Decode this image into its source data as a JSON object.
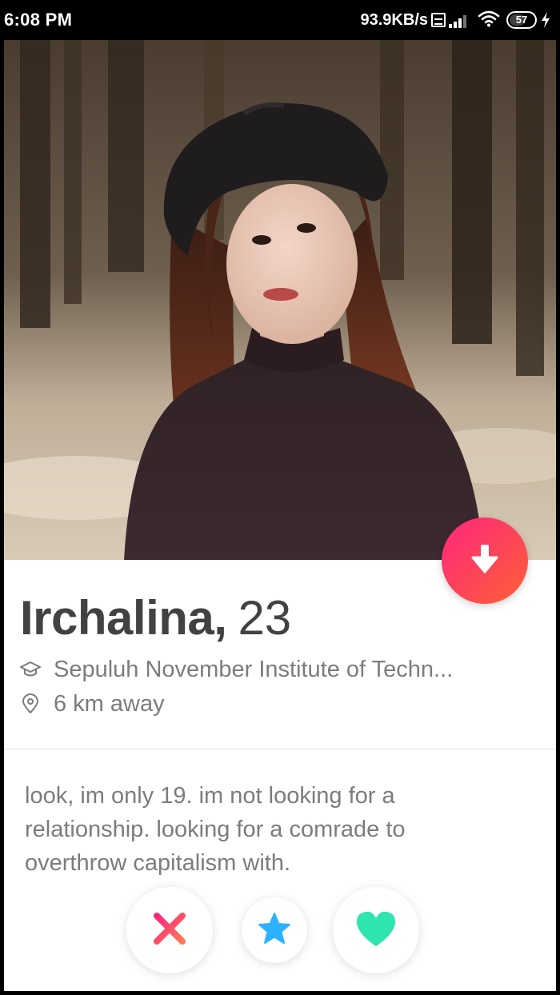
{
  "status_bar": {
    "time": "6:08 PM",
    "network_speed": "93.9KB/s",
    "battery_level": "57",
    "icons": [
      "volte-icon",
      "signal-icon",
      "wifi-icon",
      "battery-icon",
      "charging-bolt-icon"
    ]
  },
  "profile": {
    "photo_icon": "profile-photo",
    "name": "Irchalina,",
    "age": "23",
    "school": "Sepuluh November Institute of Techn...",
    "distance": "6 km away",
    "bio": "look, im only 19. im not looking for a relationship. looking for a comrade to overthrow capitalism with."
  },
  "actions": {
    "collapse_icon": "arrow-down-icon",
    "nope_icon": "x-icon",
    "superlike_icon": "star-icon",
    "like_icon": "heart-icon"
  },
  "colors": {
    "brand_gradient_start": "#fd267d",
    "brand_gradient_end": "#ff6036",
    "nope": "#fd5068",
    "superlike": "#2db2ff",
    "like": "#2ee5b0",
    "name_text": "#424242",
    "secondary_text": "#7c7c7c"
  }
}
